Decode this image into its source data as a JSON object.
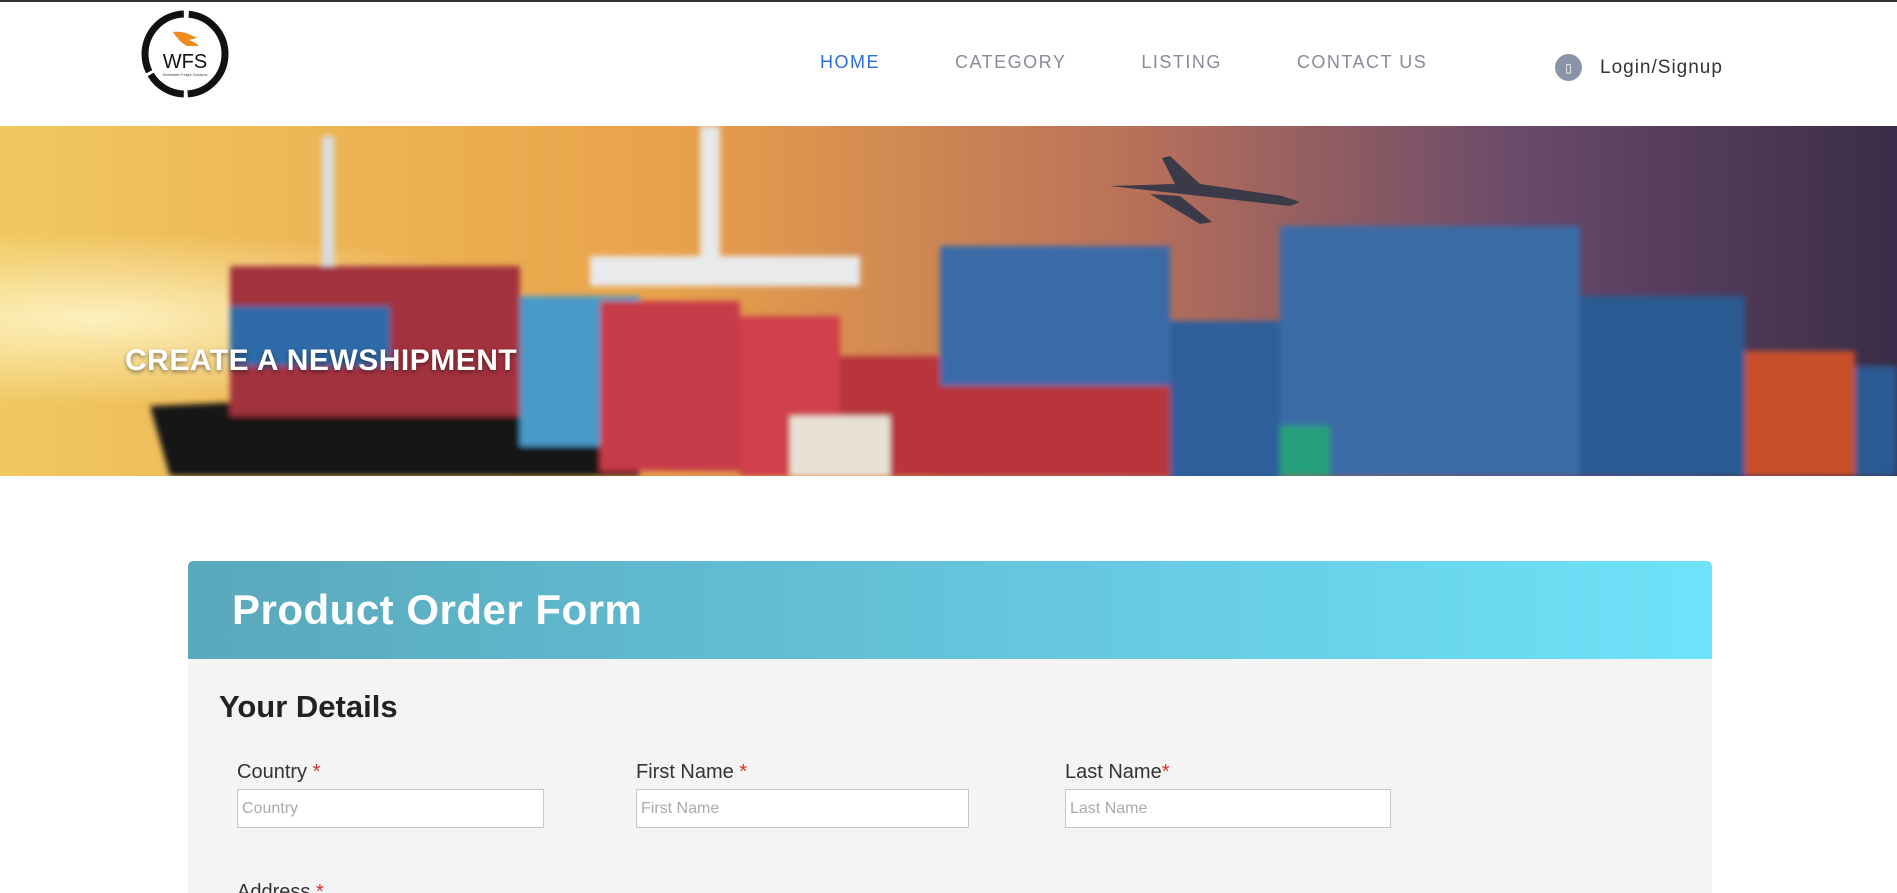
{
  "brand": {
    "logo_text": "WFS",
    "logo_subtext": "Worldwide Freight Solutions",
    "logo_wing_color": "#f08a1c"
  },
  "nav": {
    "items": [
      {
        "label": "HOME",
        "active": true
      },
      {
        "label": "CATEGORY",
        "active": false
      },
      {
        "label": "LISTING",
        "active": false
      },
      {
        "label": "CONTACT US",
        "active": false
      }
    ],
    "active_color": "#2a6fd6",
    "inactive_color": "#8a8a9a"
  },
  "login": {
    "icon": "user-icon",
    "label": "Login/Signup"
  },
  "hero": {
    "title": "CREATE A NEWSHIPMENT",
    "image": "cargo-ship-containers-airplane"
  },
  "form": {
    "title": "Product Order Form",
    "section_title": "Your Details",
    "header_gradient": [
      "#5aa8bb",
      "#6ee3f9"
    ],
    "required_marker": "*",
    "fields": {
      "country": {
        "label": "Country",
        "placeholder": "Country",
        "value": ""
      },
      "first_name": {
        "label": "First Name",
        "placeholder": "First Name",
        "value": ""
      },
      "last_name": {
        "label": "Last Name",
        "placeholder": "Last Name",
        "value": ""
      },
      "address": {
        "label": "Address"
      }
    }
  }
}
